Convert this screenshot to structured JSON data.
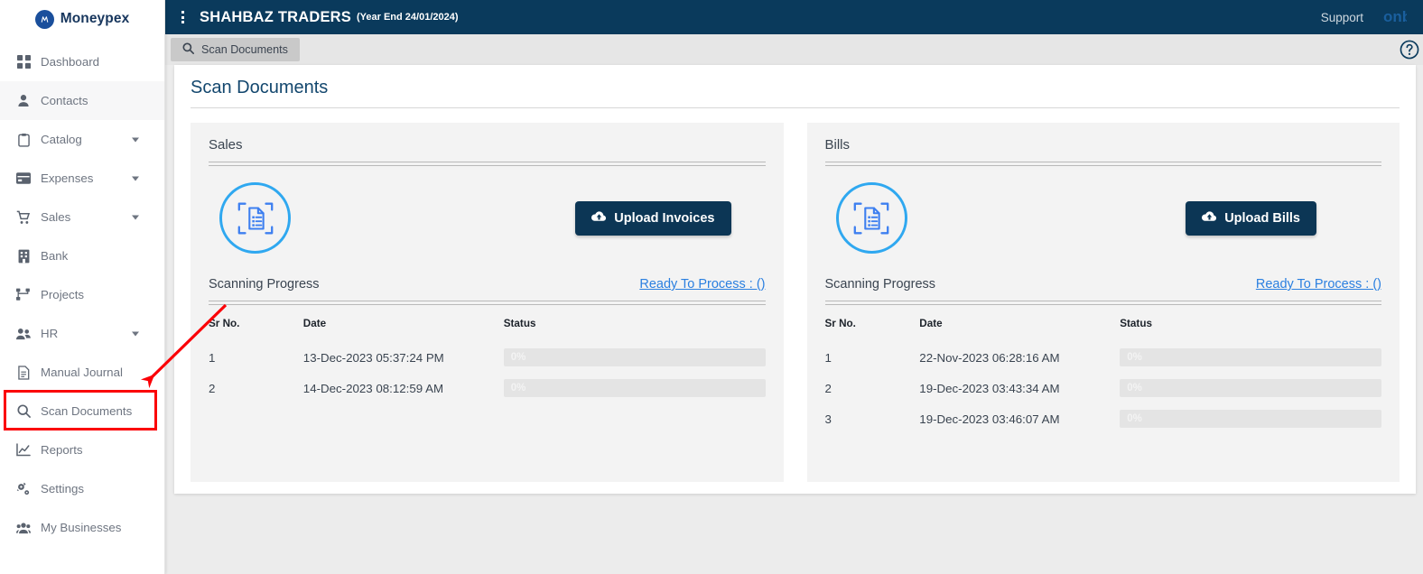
{
  "brand": {
    "logo_glyph": "m",
    "name": "Moneypex"
  },
  "sidebar": {
    "items": [
      {
        "label": "Dashboard",
        "icon": "grid-icon",
        "caret": false,
        "active": false
      },
      {
        "label": "Contacts",
        "icon": "person-icon",
        "caret": false,
        "active": true
      },
      {
        "label": "Catalog",
        "icon": "clipboard-icon",
        "caret": true,
        "active": false
      },
      {
        "label": "Expenses",
        "icon": "card-icon",
        "caret": true,
        "active": false
      },
      {
        "label": "Sales",
        "icon": "cart-icon",
        "caret": true,
        "active": false
      },
      {
        "label": "Bank",
        "icon": "bank-icon",
        "caret": false,
        "active": false
      },
      {
        "label": "Projects",
        "icon": "sitemap-icon",
        "caret": false,
        "active": false
      },
      {
        "label": "HR",
        "icon": "people-icon",
        "caret": true,
        "active": false
      },
      {
        "label": "Manual Journal",
        "icon": "journal-icon",
        "caret": false,
        "active": false
      },
      {
        "label": "Scan Documents",
        "icon": "search-icon",
        "caret": false,
        "active": false
      },
      {
        "label": "Reports",
        "icon": "chart-line-icon",
        "caret": false,
        "active": false
      },
      {
        "label": "Settings",
        "icon": "gears-icon",
        "caret": false,
        "active": false
      },
      {
        "label": "My Businesses",
        "icon": "people-group-icon",
        "caret": false,
        "active": false
      }
    ]
  },
  "topbar": {
    "menu_icon": "kebab-menu-icon",
    "company": "SHAHBAZ TRADERS",
    "year_end": "(Year End 24/01/2024)",
    "support_label": "Support",
    "onboarding_label": "onb"
  },
  "breadcrumb": {
    "icon": "search-icon",
    "label": "Scan Documents",
    "help_icon": "question-circle-icon"
  },
  "page": {
    "title": "Scan Documents"
  },
  "panels": [
    {
      "key": "sales",
      "title": "Sales",
      "scan_icon": "document-scan-icon",
      "upload_icon": "cloud-upload-icon",
      "upload_label": "Upload Invoices",
      "progress_title": "Scanning Progress",
      "ready_label": "Ready To Process : ()",
      "columns": [
        "Sr No.",
        "Date",
        "Status"
      ],
      "rows": [
        {
          "sr": "1",
          "date": "13-Dec-2023 05:37:24 PM",
          "status": "0%",
          "percent": 0
        },
        {
          "sr": "2",
          "date": "14-Dec-2023 08:12:59 AM",
          "status": "0%",
          "percent": 0
        }
      ]
    },
    {
      "key": "bills",
      "title": "Bills",
      "scan_icon": "document-scan-icon",
      "upload_icon": "cloud-upload-icon",
      "upload_label": "Upload Bills",
      "progress_title": "Scanning Progress",
      "ready_label": "Ready To Process : ()",
      "columns": [
        "Sr No.",
        "Date",
        "Status"
      ],
      "rows": [
        {
          "sr": "1",
          "date": "22-Nov-2023 06:28:16 AM",
          "status": "0%",
          "percent": 0
        },
        {
          "sr": "2",
          "date": "19-Dec-2023 03:43:34 AM",
          "status": "0%",
          "percent": 0
        },
        {
          "sr": "3",
          "date": "19-Dec-2023 03:46:07 AM",
          "status": "0%",
          "percent": 0
        }
      ]
    }
  ],
  "annotations": {
    "highlight_target": "Scan Documents",
    "arrow_color": "#fb0007",
    "box_color": "#fb0007"
  },
  "colors": {
    "topbar_bg": "#0a3a5c",
    "accent_blue": "#2fa8f0",
    "link_blue": "#2a7fe0",
    "button_navy": "#0c3655",
    "panel_bg": "#f3f3f3",
    "page_bg": "#ececec"
  }
}
